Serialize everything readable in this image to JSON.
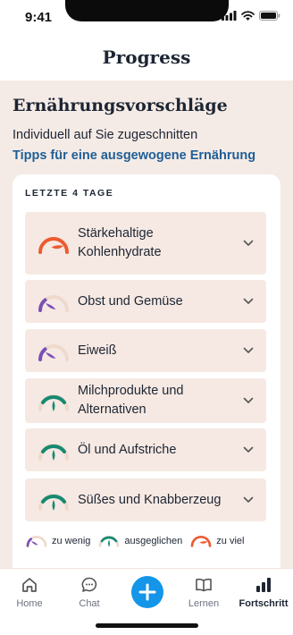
{
  "status_bar": {
    "time": "9:41"
  },
  "header": {
    "title": "Progress"
  },
  "intro": {
    "title": "Ernährungsvorschläge",
    "subtitle": "Individuell auf Sie zugeschnitten",
    "link": "Tipps für eine ausgewogene Ernährung"
  },
  "card": {
    "heading": "LETZTE 4 TAGE",
    "items": [
      {
        "label": "Stärkehaltige Kohlenhydrate",
        "status": "zu viel"
      },
      {
        "label": "Obst und Gemüse",
        "status": "zu wenig"
      },
      {
        "label": "Eiweiß",
        "status": "zu wenig"
      },
      {
        "label": "Milchprodukte und Alternativen",
        "status": "ausgeglichen"
      },
      {
        "label": "Öl und Aufstriche",
        "status": "ausgeglichen"
      },
      {
        "label": "Süßes und Knabberzeug",
        "status": "ausgeglichen"
      }
    ],
    "legend": {
      "low": "zu wenig",
      "balanced": "ausgeglichen",
      "high": "zu viel"
    }
  },
  "status_colors": {
    "zu wenig": "#7b4fb5",
    "ausgeglichen": "#168a71",
    "zu viel": "#ec5b30",
    "track": "#efd9cc",
    "link": "#1f5e96",
    "fab": "#1495e8"
  },
  "tabbar": {
    "items": [
      {
        "label": "Home",
        "icon": "home-icon"
      },
      {
        "label": "Chat",
        "icon": "chat-icon"
      },
      {
        "label": "",
        "icon": "plus-icon"
      },
      {
        "label": "Lernen",
        "icon": "book-icon"
      },
      {
        "label": "Fortschritt",
        "icon": "bar-chart-icon",
        "active": true
      }
    ]
  }
}
